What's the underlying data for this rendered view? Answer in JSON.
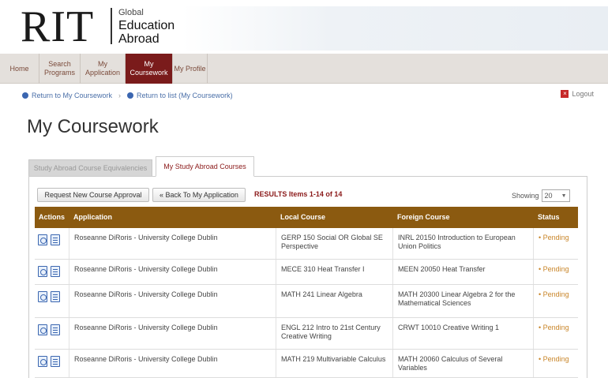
{
  "logo": {
    "main": "RIT",
    "line1": "Global",
    "line2": "Education",
    "line3": "Abroad"
  },
  "nav": [
    {
      "label": "Home"
    },
    {
      "label": "Search Programs"
    },
    {
      "label": "My Application"
    },
    {
      "label": "My Coursework"
    },
    {
      "label": "My Profile"
    }
  ],
  "breadcrumbs": {
    "return_coursework": "Return to My Coursework",
    "return_list": "Return to list (My Coursework)"
  },
  "logout": "Logout",
  "page_title": "My Coursework",
  "tabs": {
    "inactive": "Study Abroad Course Equivalencies",
    "active": "My Study Abroad Courses"
  },
  "toolbar": {
    "request_button": "Request New Course Approval",
    "back_button": "« Back To My Application",
    "results": "RESULTS Items 1-14 of 14",
    "showing_label": "Showing",
    "showing_value": "20"
  },
  "table": {
    "headers": [
      "Actions",
      "Application",
      "Local Course",
      "Foreign Course",
      "Status"
    ],
    "rows": [
      {
        "application": "Roseanne DiRoris - University College Dublin",
        "local": "GERP 150 Social OR Global SE Perspective",
        "foreign": "INRL 20150 Introduction to European Union Politics",
        "status": "• Pending"
      },
      {
        "application": "Roseanne DiRoris - University College Dublin",
        "local": "MECE 310 Heat Transfer I",
        "foreign": "MEEN 20050 Heat Transfer",
        "status": "• Pending"
      },
      {
        "application": "Roseanne DiRoris - University College Dublin",
        "local": "MATH 241 Linear Algebra",
        "foreign": "MATH 20300 Linear Algebra 2 for the Mathematical Sciences",
        "status": "• Pending"
      },
      {
        "application": "Roseanne DiRoris - University College Dublin",
        "local": "ENGL 212 Intro to 21st Century Creative Writing",
        "foreign": "CRWT 10010 Creative Writing 1",
        "status": "• Pending"
      },
      {
        "application": "Roseanne DiRoris - University College Dublin",
        "local": "MATH 219 Multivariable Calculus",
        "foreign": "MATH 20060 Calculus of Several Variables",
        "status": "• Pending"
      }
    ]
  }
}
